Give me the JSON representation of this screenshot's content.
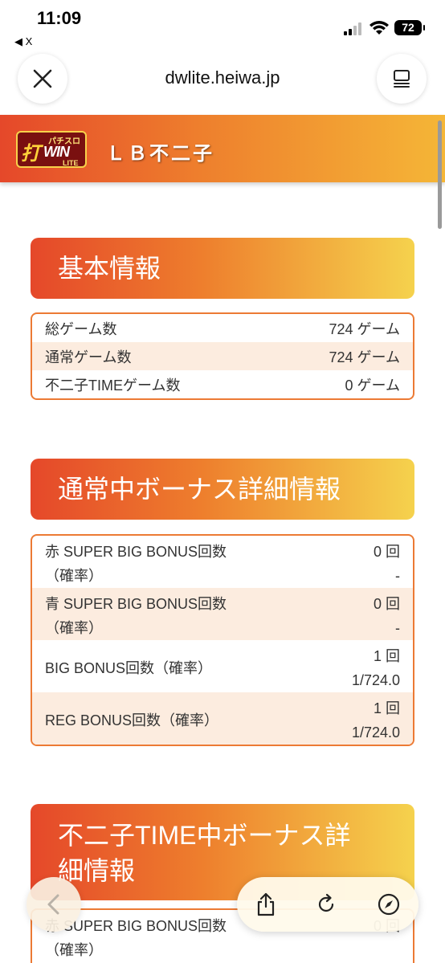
{
  "status": {
    "time": "11:09",
    "back_app": "◀ X",
    "battery": "72"
  },
  "browser": {
    "url": "dwlite.heiwa.jp"
  },
  "banner": {
    "logo_top": "パチスロ",
    "logo_main": "打",
    "logo_win": "WIN",
    "logo_lite": "LITE",
    "title": "ＬＢ不二子"
  },
  "basic": {
    "title": "基本情報",
    "rows": [
      {
        "label": "総ゲーム数",
        "value": "724 ゲーム"
      },
      {
        "label": "通常ゲーム数",
        "value": "724 ゲーム"
      },
      {
        "label": "不二子TIMEゲーム数",
        "value": "0 ゲーム"
      }
    ]
  },
  "normal_bonus": {
    "title": "通常中ボーナス詳細情報",
    "rows": [
      {
        "label1": "赤 SUPER BIG BONUS回数",
        "label2": "（確率）",
        "count": "0 回",
        "prob": "-"
      },
      {
        "label1": "青 SUPER BIG BONUS回数",
        "label2": "（確率）",
        "count": "0 回",
        "prob": "-"
      },
      {
        "label1": "BIG BONUS回数（確率）",
        "label2": "",
        "count": "1 回",
        "prob": "1/724.0"
      },
      {
        "label1": "REG BONUS回数（確率）",
        "label2": "",
        "count": "1 回",
        "prob": "1/724.0"
      }
    ]
  },
  "time_bonus": {
    "title_line1": "不二子TIME中ボーナス詳",
    "title_line2": "細情報",
    "rows": [
      {
        "label1": "赤 SUPER BIG BONUS回数",
        "label2": "（確率）",
        "count": "0 回"
      }
    ]
  }
}
